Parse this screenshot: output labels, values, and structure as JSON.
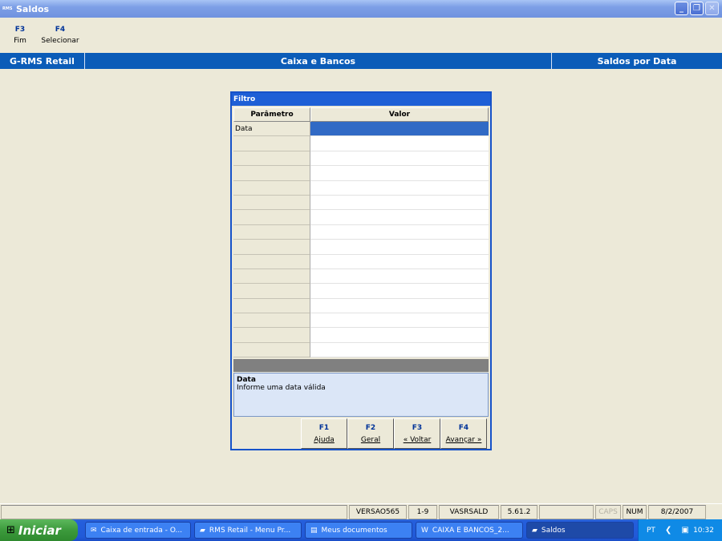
{
  "window": {
    "app_icon_text": "RMS",
    "title": "Saldos"
  },
  "fkeys": [
    {
      "key": "F3",
      "label": "Fim"
    },
    {
      "key": "F4",
      "label": "Selecionar"
    }
  ],
  "header": {
    "system": "G-RMS Retail",
    "module": "Caixa e Bancos",
    "screen": "Saldos por Data"
  },
  "filter": {
    "title": "Filtro",
    "col_param": "Parâmetro",
    "col_value": "Valor",
    "rows": [
      {
        "param": "Data",
        "value": ""
      }
    ],
    "help_title": "Data",
    "help_text": "Informe uma data válida",
    "buttons": [
      {
        "key": "F1",
        "label": "Ajuda"
      },
      {
        "key": "F2",
        "label": "Geral"
      },
      {
        "key": "F3",
        "label": "« Voltar"
      },
      {
        "key": "F4",
        "label": "Avançar »"
      }
    ]
  },
  "statusbar": {
    "version": "VERSAO565",
    "page": "1-9",
    "program": "VASRSALD",
    "release": "5.61.2",
    "caps": "CAPS",
    "num": "NUM",
    "date": "8/2/2007"
  },
  "taskbar": {
    "start": "Iniciar",
    "tasks": [
      {
        "label": "Caixa de entrada - O...",
        "icon": "mail-icon"
      },
      {
        "label": "RMS Retail - Menu Pr...",
        "icon": "rms-icon"
      },
      {
        "label": "Meus documentos",
        "icon": "folder-icon"
      },
      {
        "label": "CAIXA E BANCOS_2...",
        "icon": "word-icon"
      },
      {
        "label": "Saldos",
        "icon": "rms-icon"
      }
    ],
    "lang": "PT",
    "clock": "10:32"
  }
}
